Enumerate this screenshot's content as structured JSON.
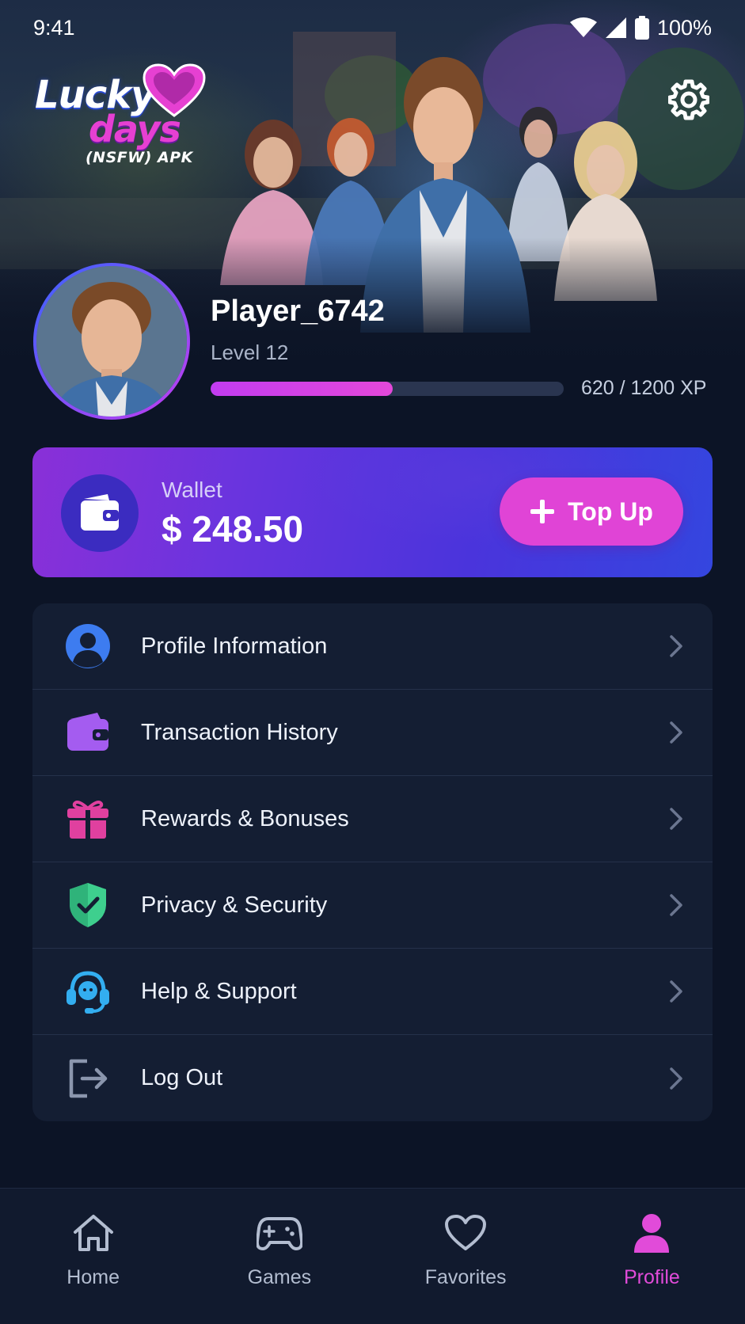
{
  "status_bar": {
    "time": "9:41",
    "battery": "100%"
  },
  "logo": {
    "line1": "Lucky",
    "line2": "days",
    "line3": "(NSFW) APK"
  },
  "profile": {
    "username": "Player_6742",
    "level": "Level 12",
    "xp_text": "620 / 1200 XP",
    "xp_current": 620,
    "xp_max": 1200
  },
  "wallet": {
    "label": "Wallet",
    "amount": "$ 248.50",
    "topup_label": "Top Up"
  },
  "menu": {
    "items": [
      {
        "label": "Profile Information",
        "icon": "user-circle-icon",
        "color": "#3d7cf0"
      },
      {
        "label": "Transaction History",
        "icon": "wallet-icon",
        "color": "#a45cf0"
      },
      {
        "label": "Rewards & Bonuses",
        "icon": "gift-icon",
        "color": "#e0409f"
      },
      {
        "label": "Privacy & Security",
        "icon": "shield-check-icon",
        "color": "#3ecf8e"
      },
      {
        "label": "Help & Support",
        "icon": "headset-icon",
        "color": "#33aef0"
      },
      {
        "label": "Log Out",
        "icon": "logout-icon",
        "color": "#8b96ad"
      }
    ]
  },
  "nav": {
    "items": [
      {
        "label": "Home",
        "icon": "home-icon"
      },
      {
        "label": "Games",
        "icon": "gamepad-icon"
      },
      {
        "label": "Favorites",
        "icon": "heart-icon"
      },
      {
        "label": "Profile",
        "icon": "person-icon",
        "active": true
      }
    ]
  },
  "colors": {
    "accent": "#e044d6",
    "background": "#0c1426",
    "card": "#141e33",
    "wallet_gradient_start": "#8a30d8",
    "wallet_gradient_end": "#3446df"
  }
}
